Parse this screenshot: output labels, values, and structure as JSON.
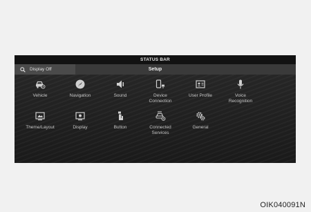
{
  "status_bar": {
    "label": "STATUS BAR"
  },
  "setup_bar": {
    "display_off": "Display Off",
    "title": "Setup"
  },
  "menu": {
    "row1": [
      {
        "label": "Vehicle",
        "icon": "vehicle-icon"
      },
      {
        "label": "Navigation",
        "icon": "compass-icon"
      },
      {
        "label": "Sound",
        "icon": "speaker-icon"
      },
      {
        "label": "Device\nConnection",
        "icon": "device-connection-icon"
      },
      {
        "label": "User Profile",
        "icon": "user-profile-icon"
      },
      {
        "label": "Voice\nRecognition",
        "icon": "microphone-icon"
      }
    ],
    "row2": [
      {
        "label": "Theme/Layout",
        "icon": "theme-layout-icon"
      },
      {
        "label": "Display",
        "icon": "display-icon"
      },
      {
        "label": "Button",
        "icon": "hand-button-icon"
      },
      {
        "label": "Connected\nServices",
        "icon": "connected-services-icon"
      },
      {
        "label": "General",
        "icon": "gear-icon"
      }
    ]
  },
  "figure_ref": "OIK040091N",
  "colors": {
    "screen_bg": "#1e1e1e",
    "icon": "#d0d0d0",
    "page_bg": "#f1f1f1"
  }
}
